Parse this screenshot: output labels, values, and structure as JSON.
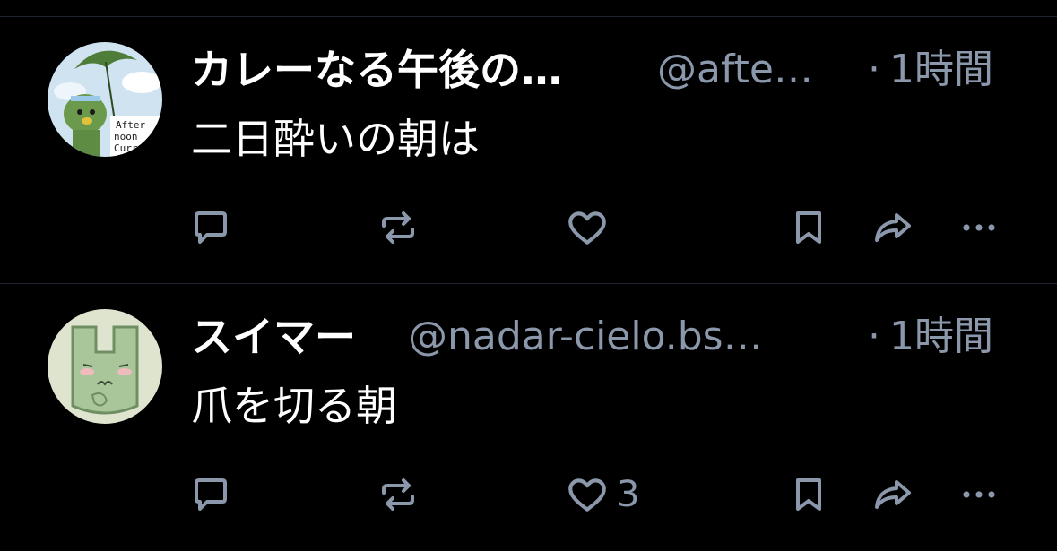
{
  "theme": {
    "background": "#000000",
    "text": "#ffffff",
    "muted": "#8b97aa",
    "separator": "#1f2530"
  },
  "posts": [
    {
      "author_name": "カレーなる午後の…",
      "handle": "@afte…",
      "time": "1時間",
      "dot": "·",
      "text": "二日酔いの朝は",
      "avatar_icon": "kappa-umbrella-avatar",
      "avatar_text": [
        "After",
        "noon",
        "Curry"
      ],
      "like_count": ""
    },
    {
      "author_name": "スイマー",
      "handle": "@nadar-cielo.bs…",
      "time": "1時間",
      "dot": "·",
      "text": "爪を切る朝",
      "avatar_icon": "green-creature-avatar",
      "like_count": "3"
    }
  ],
  "action_icons": [
    "reply-icon",
    "repost-icon",
    "like-icon",
    "bookmark-icon",
    "share-icon",
    "more-icon"
  ]
}
